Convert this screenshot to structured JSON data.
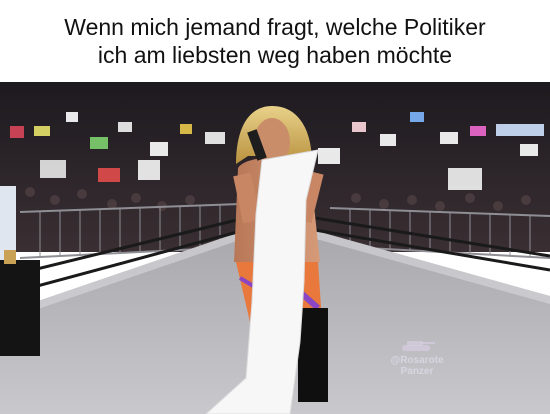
{
  "caption": {
    "line1": "Wenn mich jemand fragt, welche Politiker",
    "line2": "ich am liebsten weg haben möchte"
  },
  "watermark": {
    "line1": "@Rosarote",
    "line2": "Panzer",
    "icon": "tank-icon"
  },
  "colors": {
    "background": "#ffffff",
    "caption_text": "#111111",
    "ring_mat": "#b9b8bd",
    "crowd": "#2a2226",
    "scroll_paper": "#f4f4f4"
  }
}
